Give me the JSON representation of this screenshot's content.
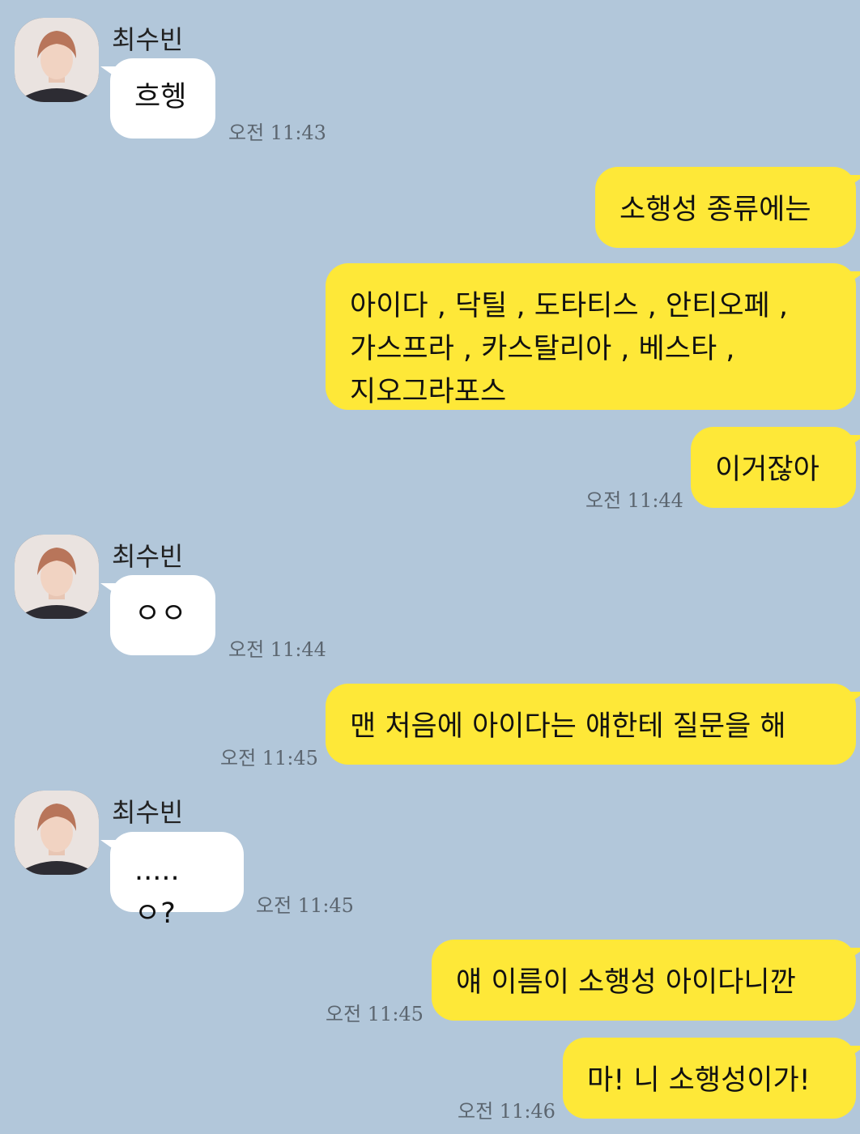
{
  "chat": {
    "sender_name": "최수빈",
    "colors": {
      "background": "#b2c7da",
      "outgoing_bubble": "#fee838",
      "incoming_bubble": "#ffffff"
    },
    "messages": [
      {
        "direction": "in",
        "sender": "최수빈",
        "text": "흐헹",
        "time": "오전 11:43"
      },
      {
        "direction": "out",
        "text": "소행성 종류에는"
      },
      {
        "direction": "out",
        "text": "아이다 , 닥틸 , 도타티스 , 안티오페 ,\n가스프라 , 카스탈리아 , 베스타 ,\n지오그라포스"
      },
      {
        "direction": "out",
        "text": "이거잖아",
        "time": "오전 11:44"
      },
      {
        "direction": "in",
        "sender": "최수빈",
        "text": "ㅇㅇ",
        "time": "오전 11:44"
      },
      {
        "direction": "out",
        "text": "맨 처음에 아이다는 얘한테 질문을 해",
        "time": "오전 11:45"
      },
      {
        "direction": "in",
        "sender": "최수빈",
        "text": ".....ㅇ?",
        "time": "오전 11:45"
      },
      {
        "direction": "out",
        "text": "얘 이름이 소행성 아이다니깐",
        "time": "오전 11:45"
      },
      {
        "direction": "out",
        "text": "마! 니 소행성이가!",
        "time": "오전 11:46"
      }
    ]
  }
}
